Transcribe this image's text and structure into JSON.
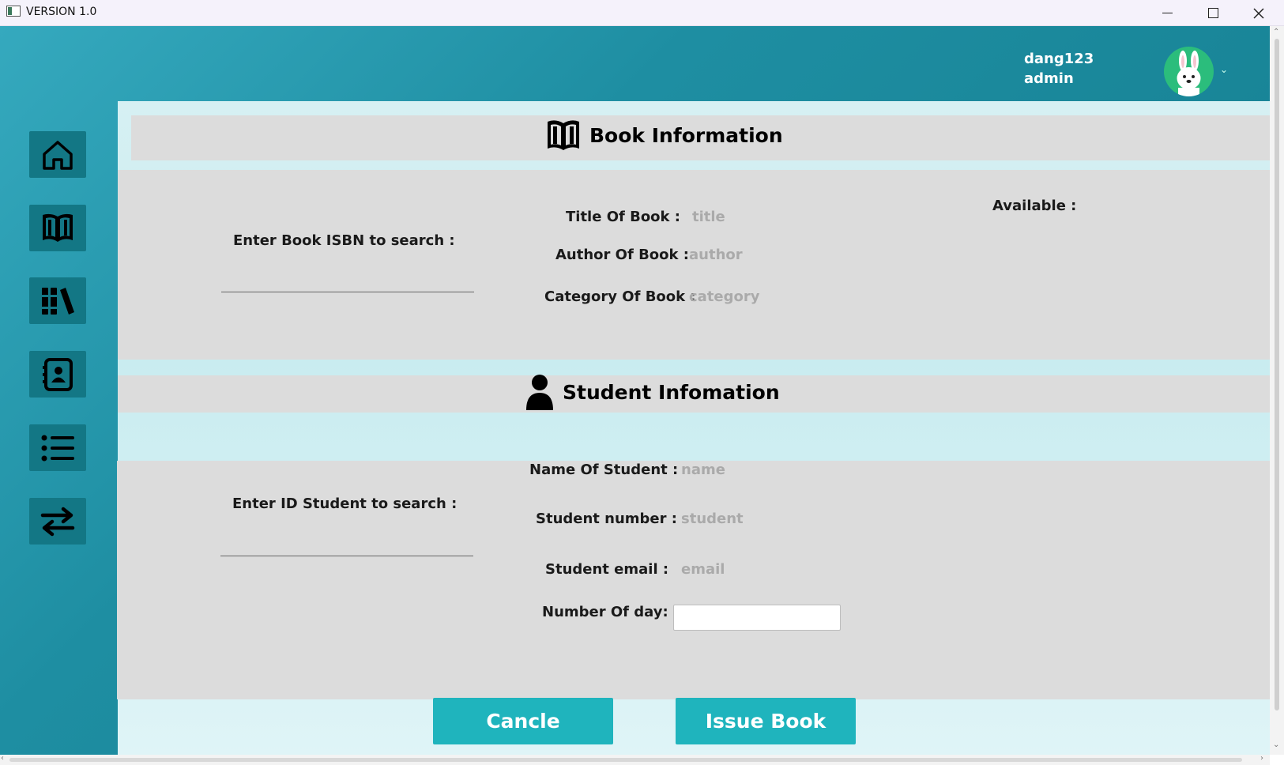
{
  "window": {
    "title": "VERSION 1.0"
  },
  "header": {
    "username": "dang123",
    "role": "admin"
  },
  "sidebar": {
    "items": [
      {
        "icon": "home-icon"
      },
      {
        "icon": "book-icon"
      },
      {
        "icon": "library-icon"
      },
      {
        "icon": "contacts-icon"
      },
      {
        "icon": "list-icon"
      },
      {
        "icon": "transfer-icon"
      }
    ]
  },
  "book_section": {
    "title": "Book Information",
    "isbn_label": "Enter Book ISBN to search :",
    "title_label": "Title Of Book :",
    "title_value": "title",
    "author_label": "Author Of Book :",
    "author_value": "author",
    "category_label": "Category Of Book :",
    "category_value": "category",
    "available_label": "Available :"
  },
  "student_section": {
    "title": "Student Infomation",
    "id_label": "Enter ID Student to search :",
    "name_label": "Name Of Student :",
    "name_value": "name",
    "number_label": "Student number :",
    "number_value": "student",
    "email_label": "Student email :",
    "email_value": "email",
    "days_label": "Number Of day:"
  },
  "actions": {
    "cancel_label": "Cancle",
    "issue_label": "Issue Book"
  }
}
